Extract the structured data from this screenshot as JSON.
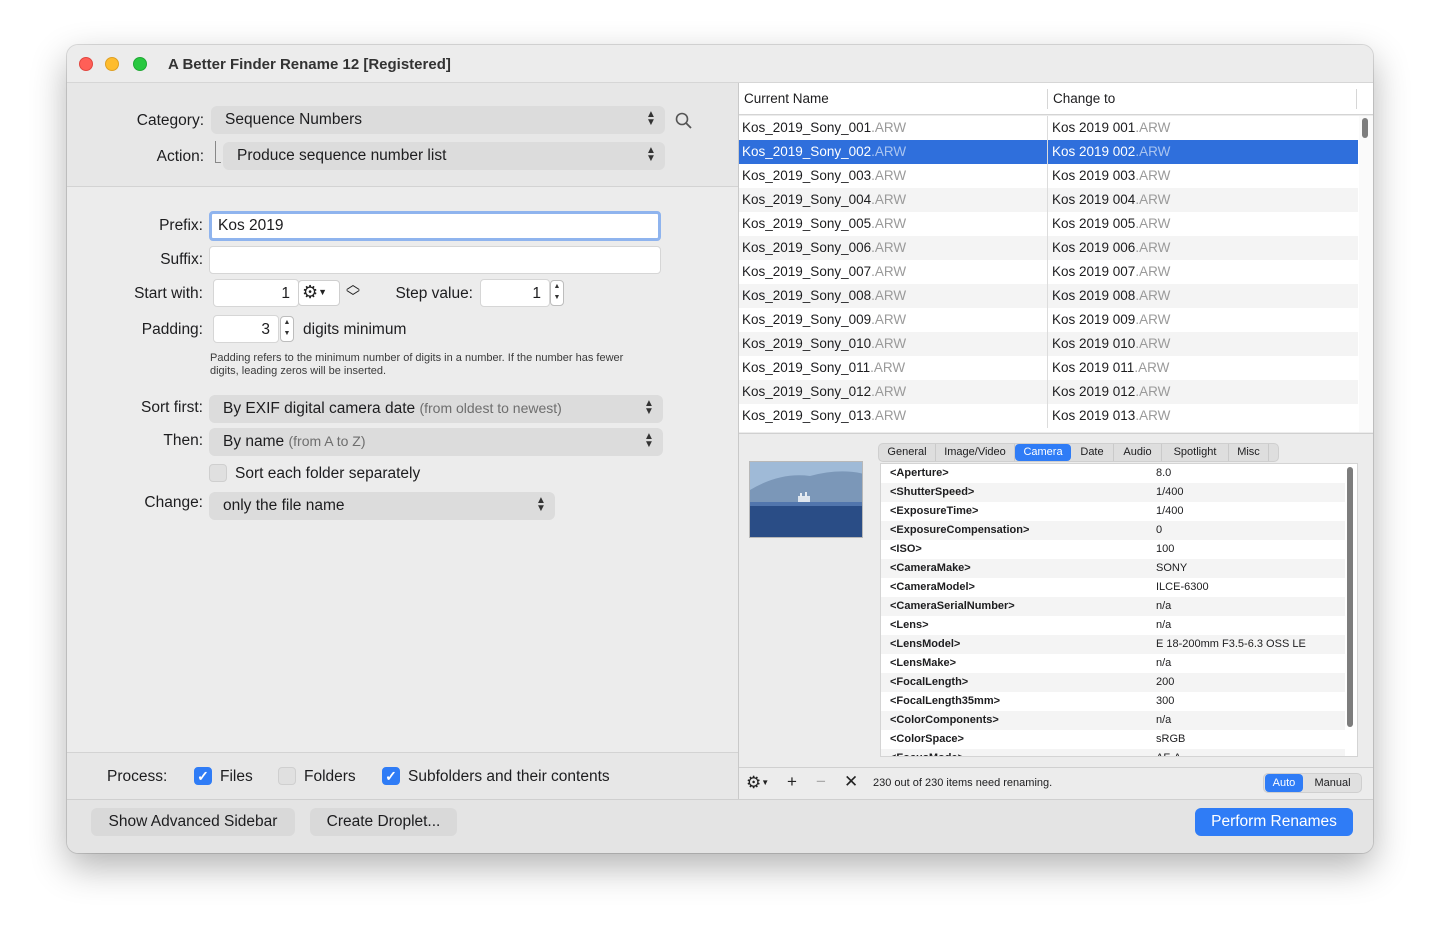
{
  "window": {
    "title": "A Better Finder Rename 12 [Registered]"
  },
  "rename_settings": {
    "category_label": "Category:",
    "category_value": "Sequence Numbers",
    "action_label": "Action:",
    "action_value": "Produce sequence number list",
    "prefix_label": "Prefix:",
    "prefix_value": "Kos 2019",
    "suffix_label": "Suffix:",
    "suffix_value": "",
    "start_label": "Start with:",
    "start_value": "1",
    "step_label": "Step value:",
    "step_value": "1",
    "padding_label": "Padding:",
    "padding_value": "3",
    "padding_unit": "digits minimum",
    "padding_hint_1": "Padding refers to the minimum number of digits in a number. If the number has fewer",
    "padding_hint_2": "digits, leading zeros will be inserted.",
    "sort_first_label": "Sort first:",
    "sort_first_value": "By EXIF digital camera date",
    "sort_first_sub": "(from oldest to newest)",
    "then_label": "Then:",
    "then_value": "By name",
    "then_sub": "(from A to Z)",
    "sort_each_folder": "Sort each folder separately",
    "sort_each_folder_checked": false,
    "change_label": "Change:",
    "change_value": "only the file name"
  },
  "process": {
    "label": "Process:",
    "files": "Files",
    "files_checked": true,
    "folders": "Folders",
    "folders_checked": false,
    "subfolders": "Subfolders and their contents",
    "subfolders_checked": true
  },
  "buttons": {
    "advanced_sidebar": "Show Advanced Sidebar",
    "create_droplet": "Create Droplet...",
    "perform": "Perform Renames"
  },
  "file_table": {
    "col_current": "Current Name",
    "col_change": "Change to",
    "selected_index": 1,
    "rows": [
      {
        "current": "Kos_2019_Sony_001",
        "change": "Kos 2019 001",
        "ext": ".ARW"
      },
      {
        "current": "Kos_2019_Sony_002",
        "change": "Kos 2019 002",
        "ext": ".ARW"
      },
      {
        "current": "Kos_2019_Sony_003",
        "change": "Kos 2019 003",
        "ext": ".ARW"
      },
      {
        "current": "Kos_2019_Sony_004",
        "change": "Kos 2019 004",
        "ext": ".ARW"
      },
      {
        "current": "Kos_2019_Sony_005",
        "change": "Kos 2019 005",
        "ext": ".ARW"
      },
      {
        "current": "Kos_2019_Sony_006",
        "change": "Kos 2019 006",
        "ext": ".ARW"
      },
      {
        "current": "Kos_2019_Sony_007",
        "change": "Kos 2019 007",
        "ext": ".ARW"
      },
      {
        "current": "Kos_2019_Sony_008",
        "change": "Kos 2019 008",
        "ext": ".ARW"
      },
      {
        "current": "Kos_2019_Sony_009",
        "change": "Kos 2019 009",
        "ext": ".ARW"
      },
      {
        "current": "Kos_2019_Sony_010",
        "change": "Kos 2019 010",
        "ext": ".ARW"
      },
      {
        "current": "Kos_2019_Sony_011",
        "change": "Kos 2019 011",
        "ext": ".ARW"
      },
      {
        "current": "Kos_2019_Sony_012",
        "change": "Kos 2019 012",
        "ext": ".ARW"
      },
      {
        "current": "Kos_2019_Sony_013",
        "change": "Kos 2019 013",
        "ext": ".ARW"
      }
    ]
  },
  "info_tabs": {
    "active": "Camera",
    "items": [
      "General",
      "Image/Video",
      "Camera",
      "Date",
      "Audio",
      "Spotlight",
      "Misc"
    ]
  },
  "metadata": [
    {
      "key": "<Aperture>",
      "value": "8.0"
    },
    {
      "key": "<ShutterSpeed>",
      "value": "1/400"
    },
    {
      "key": "<ExposureTime>",
      "value": "1/400"
    },
    {
      "key": "<ExposureCompensation>",
      "value": "0"
    },
    {
      "key": "<ISO>",
      "value": "100"
    },
    {
      "key": "<CameraMake>",
      "value": "SONY"
    },
    {
      "key": "<CameraModel>",
      "value": "ILCE-6300"
    },
    {
      "key": "<CameraSerialNumber>",
      "value": "n/a"
    },
    {
      "key": "<Lens>",
      "value": "n/a"
    },
    {
      "key": "<LensModel>",
      "value": "E 18-200mm F3.5-6.3 OSS LE"
    },
    {
      "key": "<LensMake>",
      "value": "n/a"
    },
    {
      "key": "<FocalLength>",
      "value": "200"
    },
    {
      "key": "<FocalLength35mm>",
      "value": "300"
    },
    {
      "key": "<ColorComponents>",
      "value": "n/a"
    },
    {
      "key": "<ColorSpace>",
      "value": "sRGB"
    },
    {
      "key": "<FocusMode>",
      "value": "AF-A"
    }
  ],
  "status": {
    "text": "230 out of 230 items need renaming.",
    "mode_auto": "Auto",
    "mode_manual": "Manual",
    "mode_active": "Auto"
  },
  "colors": {
    "accent": "#2f7cf6",
    "selection": "#2f6fdc",
    "focus_ring": "#8fb4ee"
  }
}
